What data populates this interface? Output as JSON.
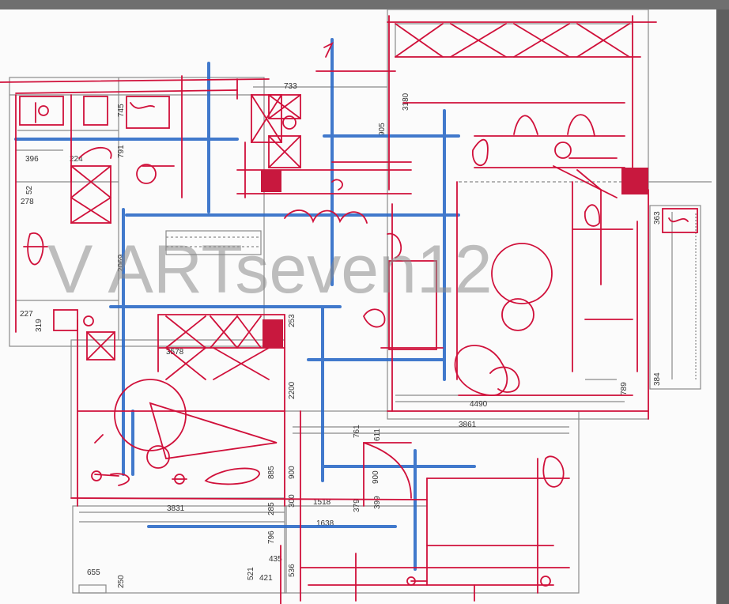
{
  "watermark": "V   ARTseven12",
  "colors": {
    "background": "#6f6f6f",
    "sheet": "#fbfbfb",
    "wall": "#8a8a8a",
    "markup_red": "#d0103a",
    "markup_blue": "#2d6cc8",
    "fill_red": "#c8183e"
  },
  "dimensions": {
    "d733": "733",
    "d3180": "3180",
    "d745": "745",
    "d905": "905",
    "d791": "791",
    "d396": "396",
    "d224": "224",
    "d52": "52",
    "d278": "278",
    "d2069": "2069",
    "d227": "227",
    "d319": "319",
    "d253": "253",
    "d3578": "3578",
    "d2200": "2200",
    "d363": "363",
    "d789": "789",
    "d384": "384",
    "d4490": "4490",
    "d3861": "3861",
    "d761": "761",
    "d611": "611",
    "d885": "885",
    "d900a": "900",
    "d900b": "900",
    "d300": "300",
    "d285": "285",
    "d1518": "1518",
    "d379": "379",
    "d399": "399",
    "d3831": "3831",
    "d1638": "1638",
    "d796": "796",
    "d435": "435",
    "d521": "521",
    "d421": "421",
    "d536": "536",
    "d655": "655",
    "d250": "250"
  }
}
